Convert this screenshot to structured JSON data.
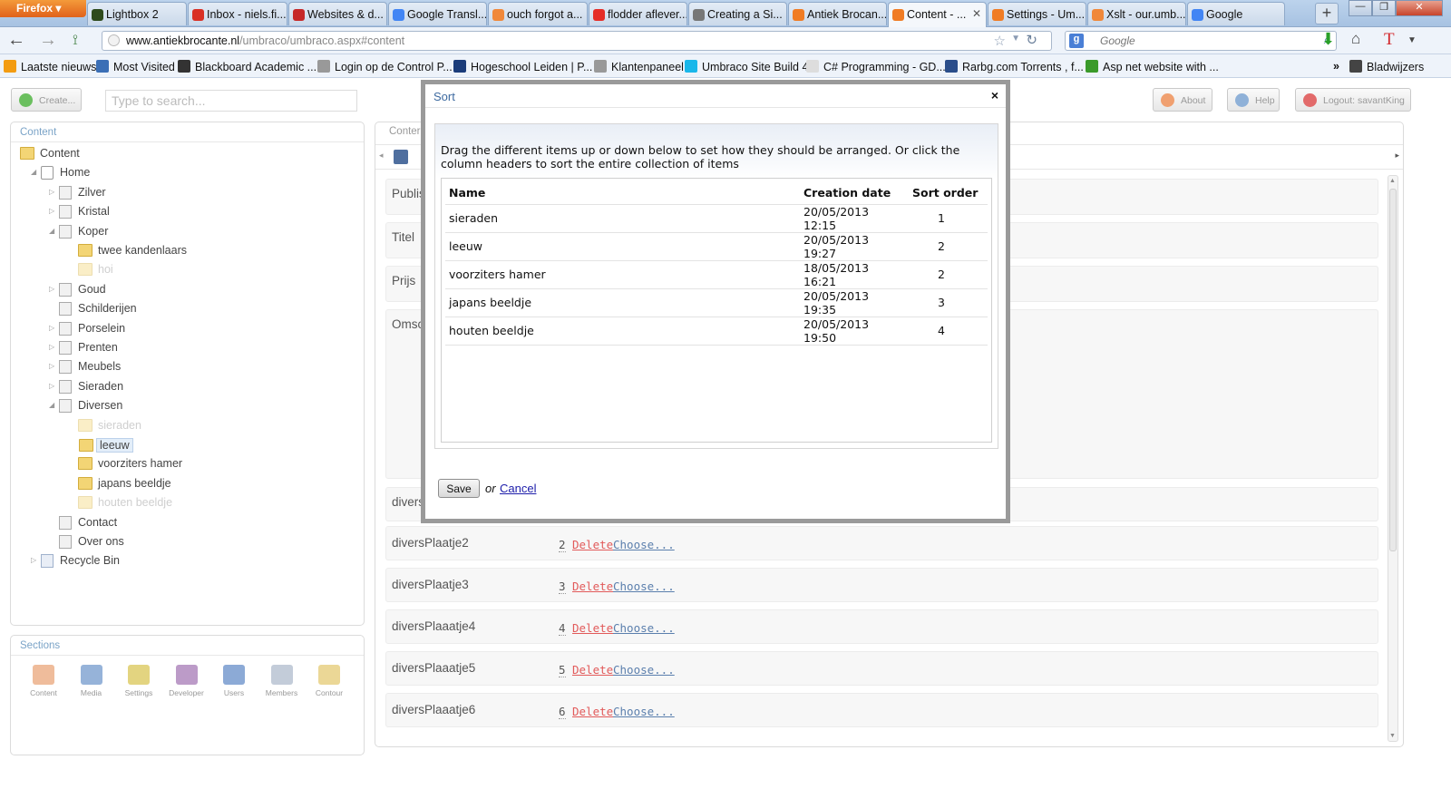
{
  "browser": {
    "app_button": "Firefox",
    "tabs": [
      {
        "label": "Lightbox 2",
        "icon": "lightbox-icon",
        "color": "#2e4a1c"
      },
      {
        "label": "Inbox - niels.fi...",
        "icon": "gmail-icon",
        "color": "#d93025"
      },
      {
        "label": "Websites & d...",
        "icon": "red-bars-icon",
        "color": "#c62828"
      },
      {
        "label": "Google Transl...",
        "icon": "translate-icon",
        "color": "#4285f4"
      },
      {
        "label": "ouch forgot a...",
        "icon": "umbraco-forum-icon",
        "color": "#f0883a"
      },
      {
        "label": "flodder aflever...",
        "icon": "youtube-icon",
        "color": "#e52d27"
      },
      {
        "label": "Creating a Si...",
        "icon": "gear-icon",
        "color": "#777777"
      },
      {
        "label": "Antiek Brocan...",
        "icon": "umbraco-icon",
        "color": "#f07c24"
      },
      {
        "label": "Content - ...",
        "icon": "umbraco-icon",
        "color": "#f07c24",
        "active": true
      },
      {
        "label": "Settings - Um...",
        "icon": "umbraco-icon",
        "color": "#f07c24"
      },
      {
        "label": "Xslt - our.umb...",
        "icon": "umbraco-forum-icon",
        "color": "#f0883a"
      },
      {
        "label": "Google",
        "icon": "google-icon",
        "color": "#4285f4"
      }
    ],
    "new_tab": "+",
    "url_domain": "www.antiekbrocante.nl",
    "url_path": "/umbraco/umbraco.aspx#content",
    "search_placeholder": "Google",
    "bookmarks": [
      {
        "label": "Laatste nieuws",
        "color": "#f39c12"
      },
      {
        "label": "Most Visited",
        "color": "#3b6fb6"
      },
      {
        "label": "Blackboard Academic ...",
        "color": "#333333"
      },
      {
        "label": "Login op de Control P...",
        "color": "#999999"
      },
      {
        "label": "Hogeschool Leiden | P...",
        "color": "#1b3c7a"
      },
      {
        "label": "Klantenpaneel",
        "color": "#999999"
      },
      {
        "label": "Umbraco Site Build 4",
        "color": "#1ab7ea"
      },
      {
        "label": "C# Programming - GD...",
        "color": "#dddddd"
      },
      {
        "label": "Rarbg.com Torrents , f...",
        "color": "#2a4d8a"
      },
      {
        "label": "Asp net website with ...",
        "color": "#3a9a2a"
      }
    ],
    "bookmarks_menu": "Bladwijzers"
  },
  "umbraco": {
    "create_label": "Create...",
    "search_placeholder": "Type to search...",
    "about_label": "About",
    "help_label": "Help",
    "logout_label": "Logout: savantKing",
    "content_panel_title": "Content",
    "tree": [
      {
        "label": "Content",
        "type": "folder",
        "level": 0
      },
      {
        "label": "Home",
        "type": "home",
        "level": 1,
        "expanded": true
      },
      {
        "label": "Zilver",
        "type": "page",
        "level": 2
      },
      {
        "label": "Kristal",
        "type": "page",
        "level": 2
      },
      {
        "label": "Koper",
        "type": "page",
        "level": 2,
        "expanded": true
      },
      {
        "label": "twee kandenlaars",
        "type": "folder",
        "level": 3
      },
      {
        "label": "hoi",
        "type": "folder",
        "level": 3,
        "unpublished": true
      },
      {
        "label": "Goud",
        "type": "page",
        "level": 2
      },
      {
        "label": "Schilderijen",
        "type": "page",
        "level": 2
      },
      {
        "label": "Porselein",
        "type": "page",
        "level": 2
      },
      {
        "label": "Prenten",
        "type": "page",
        "level": 2
      },
      {
        "label": "Meubels",
        "type": "page",
        "level": 2
      },
      {
        "label": "Sieraden",
        "type": "page",
        "level": 2
      },
      {
        "label": "Diversen",
        "type": "page",
        "level": 2,
        "expanded": true
      },
      {
        "label": "sieraden",
        "type": "folder",
        "level": 3,
        "unpublished": true
      },
      {
        "label": "leeuw",
        "type": "folder",
        "level": 3,
        "selected": true
      },
      {
        "label": "voorziters hamer",
        "type": "folder",
        "level": 3
      },
      {
        "label": "japans beeldje",
        "type": "folder",
        "level": 3
      },
      {
        "label": "houten beeldje",
        "type": "folder",
        "level": 3,
        "unpublished": true
      },
      {
        "label": "Contact",
        "type": "page",
        "level": 2
      },
      {
        "label": "Over ons",
        "type": "page",
        "level": 2
      },
      {
        "label": "Recycle Bin",
        "type": "bin",
        "level": 1
      }
    ],
    "sections_title": "Sections",
    "sections": [
      {
        "label": "Content",
        "color": "#e8a070"
      },
      {
        "label": "Media",
        "color": "#6a93c9"
      },
      {
        "label": "Settings",
        "color": "#d7c24a"
      },
      {
        "label": "Developer",
        "color": "#a070b0"
      },
      {
        "label": "Users",
        "color": "#5b86c4"
      },
      {
        "label": "Members",
        "color": "#aab7c9"
      },
      {
        "label": "Contour",
        "color": "#e2c66a"
      }
    ],
    "main_tab_label": "Conter",
    "field_labels": [
      "Publis",
      "Titel",
      "Prijs",
      "Omsc",
      "divers"
    ],
    "image_rows": [
      {
        "label": "diversPlaatje2",
        "num": "2",
        "delete": "Delete",
        "choose": "Choose..."
      },
      {
        "label": "diversPlaatje3",
        "num": "3",
        "delete": "Delete",
        "choose": "Choose..."
      },
      {
        "label": "diversPlaaatje4",
        "num": "4",
        "delete": "Delete",
        "choose": "Choose..."
      },
      {
        "label": "diversPlaaatje5",
        "num": "5",
        "delete": "Delete",
        "choose": "Choose..."
      },
      {
        "label": "diversPlaaatje6",
        "num": "6",
        "delete": "Delete",
        "choose": "Choose..."
      }
    ]
  },
  "modal": {
    "title": "Sort",
    "close": "×",
    "instructions": "Drag the different items up or down below to set how they should be arranged. Or click the column headers to sort the entire collection of items",
    "columns": [
      "Name",
      "Creation date",
      "Sort order"
    ],
    "rows": [
      [
        "sieraden",
        "20/05/2013 12:15",
        "1"
      ],
      [
        "leeuw",
        "20/05/2013 19:27",
        "2"
      ],
      [
        "voorziters hamer",
        "18/05/2013 16:21",
        "2"
      ],
      [
        "japans beeldje",
        "20/05/2013 19:35",
        "3"
      ],
      [
        "houten beeldje",
        "20/05/2013 19:50",
        "4"
      ]
    ],
    "save_label": "Save",
    "or_text": "or",
    "cancel_label": "Cancel"
  }
}
